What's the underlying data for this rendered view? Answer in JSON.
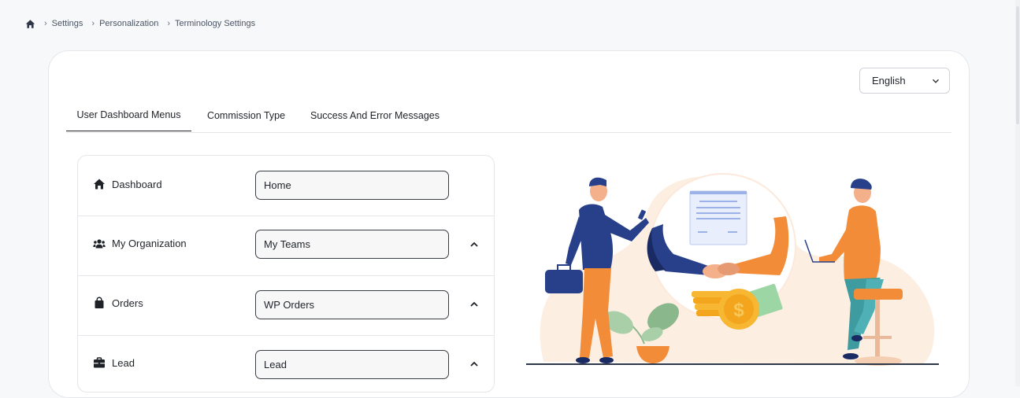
{
  "breadcrumb": {
    "items": [
      "Settings",
      "Personalization",
      "Terminology Settings"
    ]
  },
  "language": {
    "selected": "English"
  },
  "tabs": [
    {
      "label": "User Dashboard Menus",
      "active": true
    },
    {
      "label": "Commission Type",
      "active": false
    },
    {
      "label": "Success And Error Messages",
      "active": false
    }
  ],
  "menus": [
    {
      "label": "Dashboard",
      "value": "Home",
      "icon": "home-icon",
      "expandable": false
    },
    {
      "label": "My Organization",
      "value": "My Teams",
      "icon": "users-icon",
      "expandable": true
    },
    {
      "label": "Orders",
      "value": "WP Orders",
      "icon": "shopping-bag-icon",
      "expandable": true
    },
    {
      "label": "Lead",
      "value": "Lead",
      "icon": "briefcase-icon",
      "expandable": true
    }
  ],
  "illustration": {
    "icon": "handshake-illustration"
  },
  "colors": {
    "accent": "#f28c38",
    "navy": "#28408a",
    "peach": "#fce9db"
  }
}
